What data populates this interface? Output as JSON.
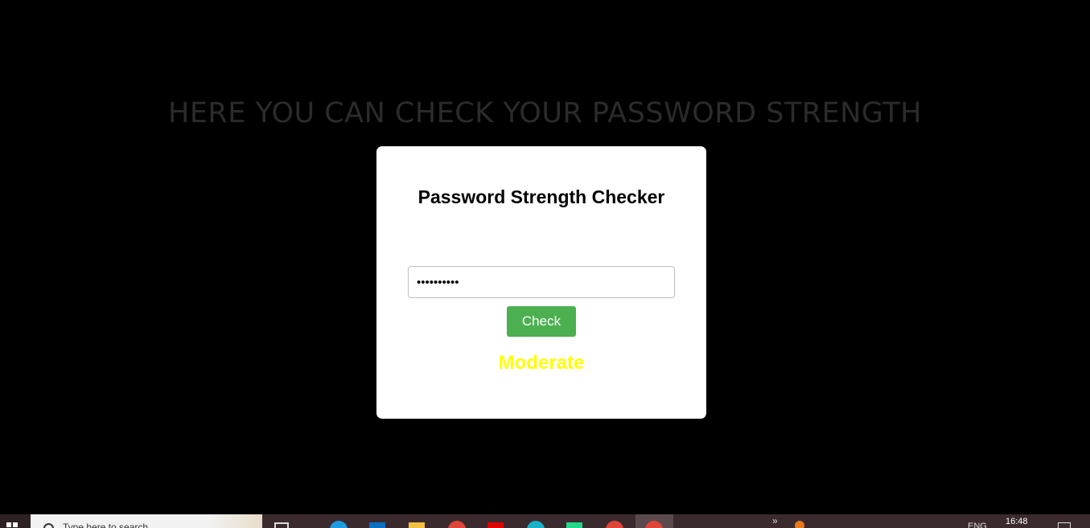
{
  "page": {
    "headline": "HERE YOU CAN CHECK YOUR PASSWORD STRENGTH"
  },
  "card": {
    "title": "Password Strength Checker",
    "password_value": "••••••••••",
    "check_label": "Check",
    "result_text": "Moderate",
    "result_color": "#ffff00"
  },
  "colors": {
    "background": "#000000",
    "headline": "#2b2b2b",
    "card": "#ffffff",
    "button": "#4caf50"
  },
  "taskbar": {
    "search_placeholder": "Type here to search",
    "clock": "16:48",
    "lang": "ENG",
    "chevron": "»",
    "apps": [
      "edge-icon",
      "store-icon",
      "file-explorer-icon",
      "chrome-icon",
      "youtube-icon",
      "app-icon",
      "pycharm-icon",
      "chrome-icon",
      "chrome-icon"
    ]
  }
}
